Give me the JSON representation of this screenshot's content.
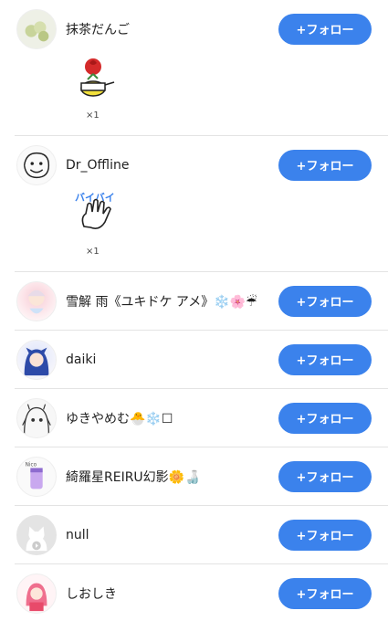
{
  "follow_label": "+フォロー",
  "accent_color": "#3b82ec",
  "users": [
    {
      "name": "抹茶だんご",
      "avatar": "matcha-dango-avatar",
      "gift": {
        "icon": "rose-teacup-sticker",
        "count": "×1"
      }
    },
    {
      "name": "Dr_Offline",
      "avatar": "smiley-doodle-avatar",
      "gift": {
        "icon": "bye-bye-hand-sticker",
        "count": "×1",
        "text": "バイバイ"
      }
    },
    {
      "name": "雪解 雨《ユキドケ アメ》❄️🌸☔",
      "avatar": "anime-girl-avatar"
    },
    {
      "name": "daiki",
      "avatar": "blue-hair-anime-avatar"
    },
    {
      "name": "ゆきやめむ🐣❄️☐",
      "avatar": "sketch-anime-avatar"
    },
    {
      "name": "綺羅星REIRU幻影🌼🍶",
      "avatar": "purple-drink-avatar"
    },
    {
      "name": "null",
      "avatar": "default-cat-avatar"
    },
    {
      "name": "しおしき",
      "avatar": "pink-hair-anime-avatar"
    }
  ]
}
